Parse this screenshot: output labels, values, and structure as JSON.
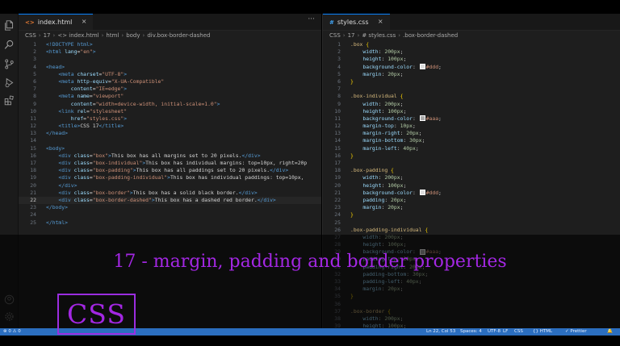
{
  "left_editor": {
    "tab": {
      "icon": "<>",
      "label": "index.html",
      "close": "×",
      "more": "···"
    },
    "breadcrumb": [
      "CSS",
      "17",
      "<> index.html",
      "html",
      "body",
      "div.box-border-dashed"
    ],
    "active_line": 22,
    "lines": [
      [
        [
          "doct",
          "<!DOCTYPE html>"
        ]
      ],
      [
        [
          "tag",
          "<html "
        ],
        [
          "attr",
          "lang"
        ],
        [
          "txt",
          "="
        ],
        [
          "str",
          "\"en\""
        ],
        [
          "tag",
          ">"
        ]
      ],
      [],
      [
        [
          "tag",
          "<head>"
        ]
      ],
      [
        [
          "txt",
          "    "
        ],
        [
          "tag",
          "<meta "
        ],
        [
          "attr",
          "charset"
        ],
        [
          "txt",
          "="
        ],
        [
          "str",
          "\"UTF-8\""
        ],
        [
          "tag",
          ">"
        ]
      ],
      [
        [
          "txt",
          "    "
        ],
        [
          "tag",
          "<meta "
        ],
        [
          "attr",
          "http-equiv"
        ],
        [
          "txt",
          "="
        ],
        [
          "str",
          "\"X-UA-Compatible\""
        ]
      ],
      [
        [
          "txt",
          "        "
        ],
        [
          "attr",
          "content"
        ],
        [
          "txt",
          "="
        ],
        [
          "str",
          "\"IE=edge\""
        ],
        [
          "tag",
          ">"
        ]
      ],
      [
        [
          "txt",
          "    "
        ],
        [
          "tag",
          "<meta "
        ],
        [
          "attr",
          "name"
        ],
        [
          "txt",
          "="
        ],
        [
          "str",
          "\"viewport\""
        ]
      ],
      [
        [
          "txt",
          "        "
        ],
        [
          "attr",
          "content"
        ],
        [
          "txt",
          "="
        ],
        [
          "str",
          "\"width=device-width, initial-scale=1.0\""
        ],
        [
          "tag",
          ">"
        ]
      ],
      [
        [
          "txt",
          "    "
        ],
        [
          "tag",
          "<link "
        ],
        [
          "attr",
          "rel"
        ],
        [
          "txt",
          "="
        ],
        [
          "str",
          "\"stylesheet\""
        ]
      ],
      [
        [
          "txt",
          "        "
        ],
        [
          "attr",
          "href"
        ],
        [
          "txt",
          "="
        ],
        [
          "str",
          "\"styles.css\""
        ],
        [
          "tag",
          ">"
        ]
      ],
      [
        [
          "txt",
          "    "
        ],
        [
          "tag",
          "<title>"
        ],
        [
          "txt",
          "CSS 17"
        ],
        [
          "tag",
          "</title>"
        ]
      ],
      [
        [
          "tag",
          "</head>"
        ]
      ],
      [],
      [
        [
          "tag",
          "<body>"
        ]
      ],
      [
        [
          "txt",
          "    "
        ],
        [
          "tag",
          "<div "
        ],
        [
          "attr",
          "class"
        ],
        [
          "txt",
          "="
        ],
        [
          "str",
          "\"box\""
        ],
        [
          "tag",
          ">"
        ],
        [
          "txt",
          "This box has all margins set to 20 pixels."
        ],
        [
          "tag",
          "</div>"
        ]
      ],
      [
        [
          "txt",
          "    "
        ],
        [
          "tag",
          "<div "
        ],
        [
          "attr",
          "class"
        ],
        [
          "txt",
          "="
        ],
        [
          "str",
          "\"box-individual\""
        ],
        [
          "tag",
          ">"
        ],
        [
          "txt",
          "This box has individual margins: top=10px, right=20p"
        ]
      ],
      [
        [
          "txt",
          "    "
        ],
        [
          "tag",
          "<div "
        ],
        [
          "attr",
          "class"
        ],
        [
          "txt",
          "="
        ],
        [
          "str",
          "\"box-padding\""
        ],
        [
          "tag",
          ">"
        ],
        [
          "txt",
          "This box has all paddings set to 20 pixels."
        ],
        [
          "tag",
          "</div>"
        ]
      ],
      [
        [
          "txt",
          "    "
        ],
        [
          "tag",
          "<div "
        ],
        [
          "attr",
          "class"
        ],
        [
          "txt",
          "="
        ],
        [
          "str",
          "\"box-padding-individual\""
        ],
        [
          "tag",
          ">"
        ],
        [
          "txt",
          "This box has individual paddings: top=10px,"
        ]
      ],
      [
        [
          "txt",
          "    "
        ],
        [
          "tag",
          "</div>"
        ]
      ],
      [
        [
          "txt",
          "    "
        ],
        [
          "tag",
          "<div "
        ],
        [
          "attr",
          "class"
        ],
        [
          "txt",
          "="
        ],
        [
          "str",
          "\"box-border\""
        ],
        [
          "tag",
          ">"
        ],
        [
          "txt",
          "This box has a solid black border."
        ],
        [
          "tag",
          "</div>"
        ]
      ],
      [
        [
          "txt",
          "    "
        ],
        [
          "tag",
          "<div "
        ],
        [
          "attr",
          "class"
        ],
        [
          "txt",
          "="
        ],
        [
          "str",
          "\"box-border-dashed\""
        ],
        [
          "tag",
          ">"
        ],
        [
          "txt",
          "This box has a dashed red border."
        ],
        [
          "tag",
          "</div>"
        ]
      ],
      [
        [
          "tag",
          "</body>"
        ]
      ],
      [],
      [
        [
          "tag",
          "</html>"
        ]
      ]
    ]
  },
  "right_editor": {
    "tab": {
      "icon": "#",
      "label": "styles.css",
      "close": "×"
    },
    "breadcrumb": [
      "CSS",
      "17",
      "# styles.css",
      ".box-border-dashed"
    ],
    "lines": [
      [
        [
          "sel",
          ".box "
        ],
        [
          "brace",
          "{"
        ]
      ],
      [
        [
          "txt",
          "    "
        ],
        [
          "prop",
          "width"
        ],
        [
          "punc",
          ": "
        ],
        [
          "num",
          "200px"
        ],
        [
          "punc",
          ";"
        ]
      ],
      [
        [
          "txt",
          "    "
        ],
        [
          "prop",
          "height"
        ],
        [
          "punc",
          ": "
        ],
        [
          "num",
          "100px"
        ],
        [
          "punc",
          ";"
        ]
      ],
      [
        [
          "txt",
          "    "
        ],
        [
          "prop",
          "background-color"
        ],
        [
          "punc",
          ": "
        ],
        [
          "swatch",
          "#dddddd"
        ],
        [
          "val",
          "#ddd"
        ],
        [
          "punc",
          ";"
        ]
      ],
      [
        [
          "txt",
          "    "
        ],
        [
          "prop",
          "margin"
        ],
        [
          "punc",
          ": "
        ],
        [
          "num",
          "20px"
        ],
        [
          "punc",
          ";"
        ]
      ],
      [
        [
          "brace",
          "}"
        ]
      ],
      [],
      [
        [
          "sel",
          ".box-individual "
        ],
        [
          "brace",
          "{"
        ]
      ],
      [
        [
          "txt",
          "    "
        ],
        [
          "prop",
          "width"
        ],
        [
          "punc",
          ": "
        ],
        [
          "num",
          "200px"
        ],
        [
          "punc",
          ";"
        ]
      ],
      [
        [
          "txt",
          "    "
        ],
        [
          "prop",
          "height"
        ],
        [
          "punc",
          ": "
        ],
        [
          "num",
          "100px"
        ],
        [
          "punc",
          ";"
        ]
      ],
      [
        [
          "txt",
          "    "
        ],
        [
          "prop",
          "background-color"
        ],
        [
          "punc",
          ": "
        ],
        [
          "swatch",
          "#aaaaaa"
        ],
        [
          "val",
          "#aaa"
        ],
        [
          "punc",
          ";"
        ]
      ],
      [
        [
          "txt",
          "    "
        ],
        [
          "prop",
          "margin-top"
        ],
        [
          "punc",
          ": "
        ],
        [
          "num",
          "10px"
        ],
        [
          "punc",
          ";"
        ]
      ],
      [
        [
          "txt",
          "    "
        ],
        [
          "prop",
          "margin-right"
        ],
        [
          "punc",
          ": "
        ],
        [
          "num",
          "20px"
        ],
        [
          "punc",
          ";"
        ]
      ],
      [
        [
          "txt",
          "    "
        ],
        [
          "prop",
          "margin-bottom"
        ],
        [
          "punc",
          ": "
        ],
        [
          "num",
          "30px"
        ],
        [
          "punc",
          ";"
        ]
      ],
      [
        [
          "txt",
          "    "
        ],
        [
          "prop",
          "margin-left"
        ],
        [
          "punc",
          ": "
        ],
        [
          "num",
          "40px"
        ],
        [
          "punc",
          ";"
        ]
      ],
      [
        [
          "brace",
          "}"
        ]
      ],
      [],
      [
        [
          "sel",
          ".box-padding "
        ],
        [
          "brace",
          "{"
        ]
      ],
      [
        [
          "txt",
          "    "
        ],
        [
          "prop",
          "width"
        ],
        [
          "punc",
          ": "
        ],
        [
          "num",
          "200px"
        ],
        [
          "punc",
          ";"
        ]
      ],
      [
        [
          "txt",
          "    "
        ],
        [
          "prop",
          "height"
        ],
        [
          "punc",
          ": "
        ],
        [
          "num",
          "100px"
        ],
        [
          "punc",
          ";"
        ]
      ],
      [
        [
          "txt",
          "    "
        ],
        [
          "prop",
          "background-color"
        ],
        [
          "punc",
          ": "
        ],
        [
          "swatch",
          "#dddddd"
        ],
        [
          "val",
          "#ddd"
        ],
        [
          "punc",
          ";"
        ]
      ],
      [
        [
          "txt",
          "    "
        ],
        [
          "prop",
          "padding"
        ],
        [
          "punc",
          ": "
        ],
        [
          "num",
          "20px"
        ],
        [
          "punc",
          ";"
        ]
      ],
      [
        [
          "txt",
          "    "
        ],
        [
          "prop",
          "margin"
        ],
        [
          "punc",
          ": "
        ],
        [
          "num",
          "20px"
        ],
        [
          "punc",
          ";"
        ]
      ],
      [
        [
          "brace",
          "}"
        ]
      ],
      [],
      [
        [
          "sel",
          ".box-padding-individual "
        ],
        [
          "brace",
          "{"
        ]
      ],
      [
        [
          "txt",
          "    "
        ],
        [
          "prop",
          "width"
        ],
        [
          "punc",
          ": "
        ],
        [
          "num",
          "200px"
        ],
        [
          "punc",
          ";"
        ]
      ],
      [
        [
          "txt",
          "    "
        ],
        [
          "prop",
          "height"
        ],
        [
          "punc",
          ": "
        ],
        [
          "num",
          "100px"
        ],
        [
          "punc",
          ";"
        ]
      ],
      [
        [
          "txt",
          "    "
        ],
        [
          "prop",
          "background-color"
        ],
        [
          "punc",
          ": "
        ],
        [
          "swatch",
          "#aaaaaa"
        ],
        [
          "val",
          "#aaa"
        ],
        [
          "punc",
          ";"
        ]
      ],
      [
        [
          "txt",
          "    "
        ],
        [
          "prop",
          "padding-top"
        ],
        [
          "punc",
          ": "
        ],
        [
          "num",
          "10px"
        ],
        [
          "punc",
          ";"
        ]
      ],
      [
        [
          "txt",
          "    "
        ],
        [
          "prop",
          "padding-right"
        ],
        [
          "punc",
          ": "
        ],
        [
          "num",
          "20px"
        ],
        [
          "punc",
          ";"
        ]
      ],
      [
        [
          "txt",
          "    "
        ],
        [
          "prop",
          "padding-bottom"
        ],
        [
          "punc",
          ": "
        ],
        [
          "num",
          "30px"
        ],
        [
          "punc",
          ";"
        ]
      ],
      [
        [
          "txt",
          "    "
        ],
        [
          "prop",
          "padding-left"
        ],
        [
          "punc",
          ": "
        ],
        [
          "num",
          "40px"
        ],
        [
          "punc",
          ";"
        ]
      ],
      [
        [
          "txt",
          "    "
        ],
        [
          "prop",
          "margin"
        ],
        [
          "punc",
          ": "
        ],
        [
          "num",
          "20px"
        ],
        [
          "punc",
          ";"
        ]
      ],
      [
        [
          "brace",
          "}"
        ]
      ],
      [],
      [
        [
          "sel",
          ".box-border "
        ],
        [
          "brace",
          "{"
        ]
      ],
      [
        [
          "txt",
          "    "
        ],
        [
          "prop",
          "width"
        ],
        [
          "punc",
          ": "
        ],
        [
          "num",
          "200px"
        ],
        [
          "punc",
          ";"
        ]
      ],
      [
        [
          "txt",
          "    "
        ],
        [
          "prop",
          "height"
        ],
        [
          "punc",
          ": "
        ],
        [
          "num",
          "100px"
        ],
        [
          "punc",
          ";"
        ]
      ]
    ]
  },
  "overlay": {
    "title": "17 - margin, padding and border properties",
    "logo": "CSS"
  },
  "activity_bar": {
    "icons": [
      "files-icon",
      "search-icon",
      "source-control-icon",
      "run-debug-icon",
      "extensions-icon"
    ]
  },
  "statusbar": {
    "left": "⊗ 0 ⚠ 0",
    "items": [
      "Ln 22, Col 53",
      "Spaces: 4",
      "UTF-8",
      "LF",
      "CSS",
      "{} HTML",
      "✓ Prettier",
      "🔔"
    ]
  },
  "colors": {
    "accent": "#0a84ff",
    "overlay_text": "#a327e3",
    "statusbar": "#2b6ebf"
  }
}
